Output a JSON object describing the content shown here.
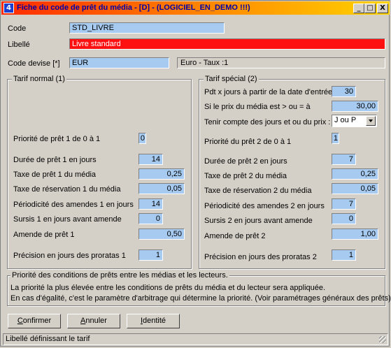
{
  "window": {
    "title": "Fiche du code de prêt du média - [D] - (LOGICIEL_EN_DEMO !!!)",
    "minimize": "_",
    "maximize": "□",
    "close": "X"
  },
  "form": {
    "code_label": "Code",
    "code_value": "STD_LIVRE",
    "libelle_label": "Libellé",
    "libelle_value": "Livre standard",
    "devise_label": "Code devise [*]",
    "devise_value": "EUR",
    "devise_info": "Euro - Taux :1"
  },
  "tarif_normal": {
    "title": "Tarif normal (1)",
    "rows": [
      {
        "label": "Priorité de prêt 1 de 0 à 1",
        "value": "0"
      },
      {
        "label": "Durée de prêt 1 en jours",
        "value": "14"
      },
      {
        "label": "Taxe de prêt 1 du média",
        "value": "0,25"
      },
      {
        "label": "Taxe de réservation 1 du média",
        "value": "0,05"
      },
      {
        "label": "Périodicité des amendes 1 en jours",
        "value": "14"
      },
      {
        "label": "Sursis 1 en jours avant amende",
        "value": "0"
      },
      {
        "label": "Amende de prêt 1",
        "value": "0,50"
      },
      {
        "label": "Précision en jours des proratas 1",
        "value": "1"
      }
    ]
  },
  "tarif_special": {
    "title": "Tarif spécial (2)",
    "pdt_label": "Pdt x jours à partir de la date d'entrée",
    "pdt_value": "30",
    "prix_label": "Si le prix du média est > ou = à",
    "prix_value": "30,00",
    "tenir_label": "Tenir compte des jours et ou du prix :",
    "tenir_value": "J ou P",
    "rows": [
      {
        "label": "Priorité du prêt 2 de 0 à 1",
        "value": "1"
      },
      {
        "label": "Durée de prêt 2 en jours",
        "value": "7"
      },
      {
        "label": "Taxe de prêt 2 du média",
        "value": "0,25"
      },
      {
        "label": "Taxe de réservation 2 du média",
        "value": "0,05"
      },
      {
        "label": "Périodicité des amendes 2 en jours",
        "value": "7"
      },
      {
        "label": "Sursis 2 en jours avant amende",
        "value": "0"
      },
      {
        "label": "Amende de prêt 2",
        "value": "1,00"
      },
      {
        "label": "Précision en jours des proratas 2",
        "value": "1"
      }
    ]
  },
  "info": {
    "title": "Priorité des conditions de prêts entre les médias et les lecteurs.",
    "line1": "La priorité la plus élevée entre les conditions de prêts du média et du lecteur sera appliquée.",
    "line2": "En cas d'égalité, c'est le paramètre d'arbitrage qui détermine la priorité. (Voir paramétrages généraux des prêts)"
  },
  "buttons": {
    "confirm": "Confirmer",
    "cancel": "Annuler",
    "identity": "Identité"
  },
  "status": "Libellé définissant le tarif"
}
